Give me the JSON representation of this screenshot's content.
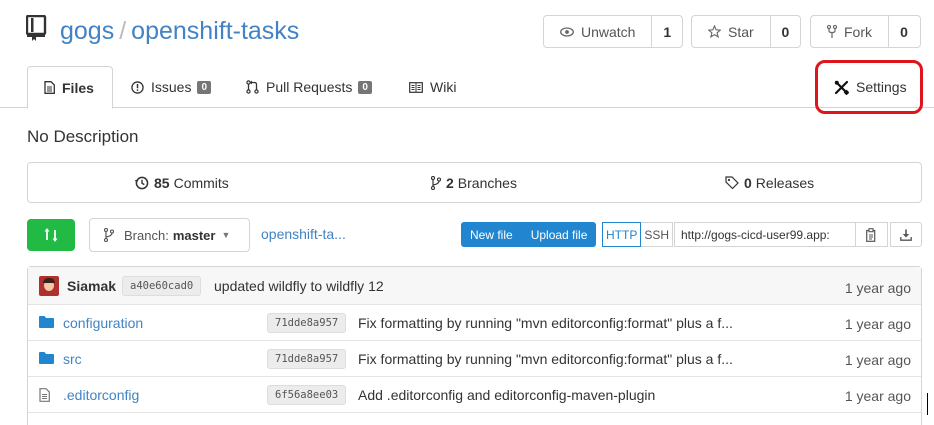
{
  "repo": {
    "owner": "gogs",
    "separator": "/",
    "name": "openshift-tasks"
  },
  "actions": {
    "watch": {
      "label": "Unwatch",
      "count": "1"
    },
    "star": {
      "label": "Star",
      "count": "0"
    },
    "fork": {
      "label": "Fork",
      "count": "0"
    }
  },
  "tabs": {
    "files": "Files",
    "issues": {
      "label": "Issues",
      "count": "0"
    },
    "pulls": {
      "label": "Pull Requests",
      "count": "0"
    },
    "wiki": "Wiki",
    "settings": "Settings"
  },
  "description": "No Description",
  "stats": {
    "commits": {
      "count": "85",
      "label": "Commits"
    },
    "branches": {
      "count": "2",
      "label": "Branches"
    },
    "releases": {
      "count": "0",
      "label": "Releases"
    }
  },
  "toolbar": {
    "branch_prefix": "Branch:",
    "branch": "master",
    "path": "openshift-ta...",
    "new_file": "New file",
    "upload_file": "Upload file",
    "http": "HTTP",
    "ssh": "SSH",
    "clone_url": "http://gogs-cicd-user99.app:"
  },
  "latest_commit": {
    "author": "Siamak",
    "sha": "a40e60cad0",
    "message": "updated wildfly to wildfly 12",
    "time": "1 year ago"
  },
  "files": [
    {
      "name": "configuration",
      "type": "folder",
      "sha": "71dde8a957",
      "message": "Fix formatting by running \"mvn editorconfig:format\" plus a f...",
      "time": "1 year ago"
    },
    {
      "name": "src",
      "type": "folder",
      "sha": "71dde8a957",
      "message": "Fix formatting by running \"mvn editorconfig:format\" plus a f...",
      "time": "1 year ago"
    },
    {
      "name": ".editorconfig",
      "type": "file",
      "sha": "6f56a8ee03",
      "message": "Add .editorconfig and editorconfig-maven-plugin",
      "time": "1 year ago"
    }
  ],
  "colors": {
    "link": "#4183c4",
    "primary": "#2185d0",
    "green": "#21ba45",
    "highlight": "#e0141d"
  }
}
